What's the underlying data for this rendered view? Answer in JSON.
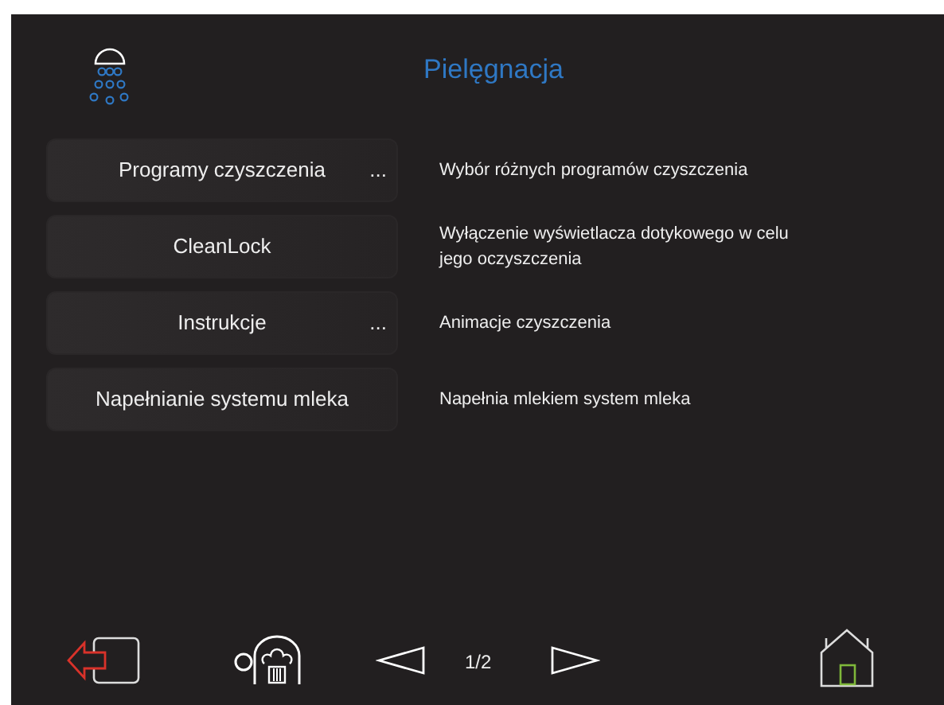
{
  "header": {
    "title": "Pielęgnacja"
  },
  "items": [
    {
      "label": "Programy czyszczenia",
      "more": "...",
      "description": "Wybór różnych programów czyszczenia"
    },
    {
      "label": "CleanLock",
      "description": "Wyłączenie wyświetlacza dotykowego w celu jego oczyszczenia"
    },
    {
      "label": "Instrukcje",
      "more": "...",
      "description": "Animacje czyszczenia"
    },
    {
      "label": "Napełnianie systemu mleka",
      "description": "Napełnia mlekiem system mleka"
    }
  ],
  "footer": {
    "page": "1/2"
  }
}
